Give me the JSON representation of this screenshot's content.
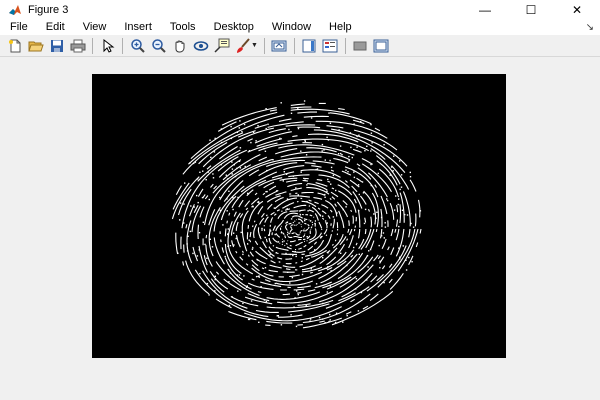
{
  "window": {
    "title": "Figure 3",
    "controls": {
      "minimize": "—",
      "maximize": "☐",
      "close": "✕"
    }
  },
  "menubar": {
    "items": [
      "File",
      "Edit",
      "View",
      "Insert",
      "Tools",
      "Desktop",
      "Window",
      "Help"
    ],
    "overflow_arrow": "↘"
  },
  "toolbar": {
    "buttons": [
      "new-figure",
      "open-file",
      "save",
      "print",
      "edit-plot",
      "zoom-in",
      "zoom-out",
      "pan",
      "rotate-3d",
      "data-cursor",
      "brush",
      "link-plot",
      "insert-colorbar",
      "insert-legend",
      "hide-plot-tools",
      "show-plot-tools"
    ]
  },
  "figure": {
    "image_description_icon": "fingerprint-image",
    "colors": {
      "background": "#000000",
      "ridges": "#ffffff",
      "window": "#f0f0f0"
    }
  }
}
